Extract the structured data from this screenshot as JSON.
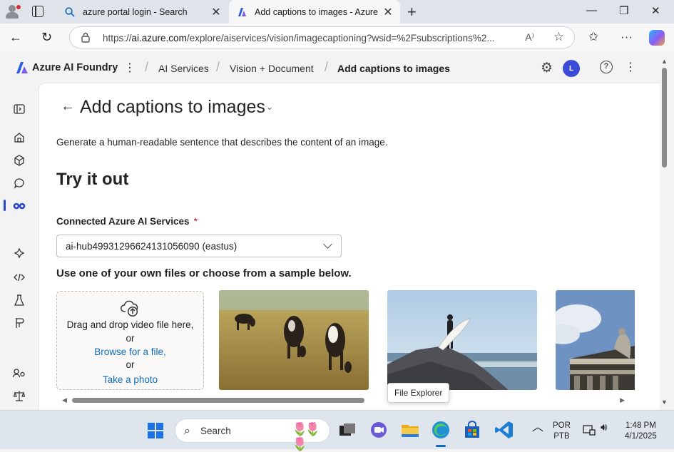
{
  "browser": {
    "tabs": [
      {
        "title": "azure portal login - Search",
        "active": false,
        "icon": "search-icon"
      },
      {
        "title": "Add captions to images - Azure AI",
        "active": true,
        "icon": "azure-ai-foundry-icon"
      }
    ],
    "url_prefix": "https://",
    "url_host": "ai.azure.com",
    "url_path": "/explore/aiservices/vision/imagecaptioning?wsid=%2Fsubscriptions%2..."
  },
  "header": {
    "brand": "Azure AI Foundry",
    "breadcrumbs": [
      "AI Services",
      "Vision + Document",
      "Add captions to images"
    ],
    "avatar_initial": "L",
    "help_label": "?"
  },
  "page": {
    "title": "Add captions to images",
    "description": "Generate a human-readable sentence that describes the content of an image.",
    "section_title": "Try it out",
    "connected_label": "Connected Azure AI Services",
    "required_mark": "*",
    "selected_service": "ai-hub49931296624131056090 (eastus)",
    "sample_hint": "Use one of your own files or choose from a sample below.",
    "upload": {
      "line1": "Drag and drop video file here,",
      "or1": "or",
      "browse": "Browse for a file,",
      "or2": "or",
      "photo": "Take a photo"
    },
    "samples": [
      "cows-grazing-image",
      "surfer-on-rock-image",
      "building-statue-image"
    ],
    "tooltip": "File Explorer"
  },
  "taskbar": {
    "search_placeholder": "Search",
    "lang_top": "POR",
    "lang_bottom": "PTB",
    "time": "1:48 PM",
    "date": "4/1/2025"
  },
  "colors": {
    "accent": "#0f6cbd",
    "required": "#c50f1f",
    "avatar": "#3b4bd8"
  }
}
